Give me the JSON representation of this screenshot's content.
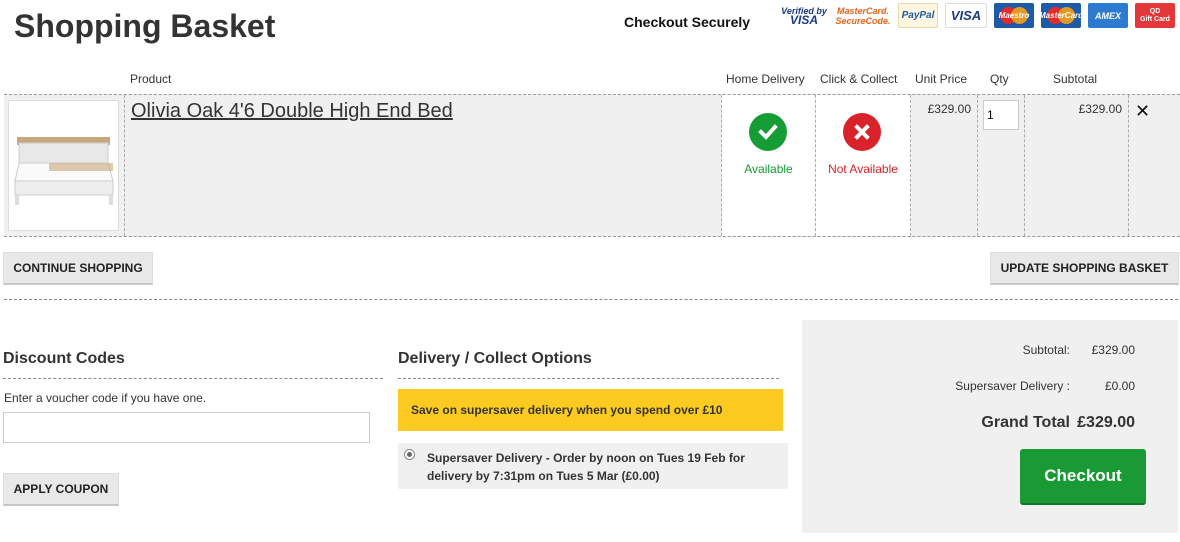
{
  "header": {
    "title": "Shopping Basket",
    "checkout_securely": "Checkout Securely",
    "payment_logos": [
      {
        "icon": "verified-by-visa-icon",
        "line1": "Verified by",
        "line2": "VISA"
      },
      {
        "icon": "mastercard-securecode-icon",
        "line1": "MasterCard.",
        "line2": "SecureCode."
      },
      {
        "icon": "paypal-icon",
        "text": "PayPal"
      },
      {
        "icon": "visa-icon",
        "text": "VISA"
      },
      {
        "icon": "maestro-icon",
        "text": "Maestro"
      },
      {
        "icon": "mastercard-icon",
        "text": "MasterCard"
      },
      {
        "icon": "amex-icon",
        "text": "AMEX"
      },
      {
        "icon": "gift-card-icon",
        "text": "QD",
        "subtext": "Gift Card"
      }
    ]
  },
  "table": {
    "headers": {
      "product": "Product",
      "home_delivery": "Home Delivery",
      "click_collect": "Click & Collect",
      "unit_price": "Unit Price",
      "qty": "Qty",
      "subtotal": "Subtotal"
    },
    "items": [
      {
        "name": "Olivia Oak 4'6 Double High End Bed",
        "home_delivery": {
          "status": "Available",
          "icon": "check-circle-icon",
          "color": "#159c35"
        },
        "click_collect": {
          "status": "Not Available",
          "icon": "cross-circle-icon",
          "color": "#d8232a"
        },
        "unit_price": "£329.00",
        "qty": "1",
        "subtotal": "£329.00"
      }
    ]
  },
  "actions": {
    "continue_shopping": "CONTINUE SHOPPING",
    "update_basket": "UPDATE SHOPPING BASKET"
  },
  "discount": {
    "heading": "Discount Codes",
    "label": "Enter a voucher code if you have one.",
    "input_value": "",
    "apply": "APPLY COUPON"
  },
  "delivery": {
    "heading": "Delivery / Collect Options",
    "promo": "Save on supersaver delivery when you spend over £10",
    "option": "Supersaver Delivery - Order by noon on Tues 19 Feb for delivery by 7:31pm on Tues 5 Mar (£0.00)"
  },
  "summary": {
    "subtotal_label": "Subtotal:",
    "subtotal_value": "£329.00",
    "delivery_label": "Supersaver Delivery :",
    "delivery_value": "£0.00",
    "grand_total_label": "Grand Total",
    "grand_total_value": "£329.00",
    "checkout": "Checkout"
  },
  "colors": {
    "accent_green": "#1a9a35",
    "promo_yellow": "#fdca22",
    "error_red": "#d8232a"
  }
}
